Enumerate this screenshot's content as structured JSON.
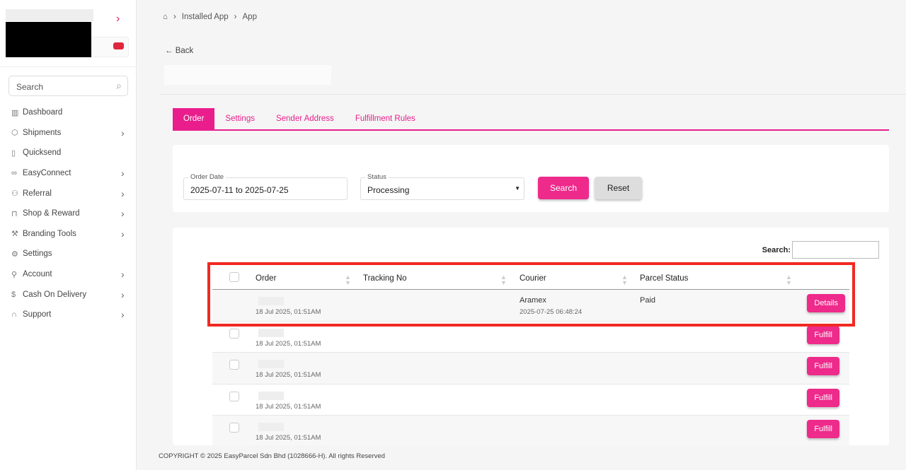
{
  "sidebar": {
    "search_placeholder": "Search",
    "items": [
      {
        "label": "Dashboard",
        "icon": "chart-icon",
        "ch": false
      },
      {
        "label": "Shipments",
        "icon": "box-icon",
        "ch": true
      },
      {
        "label": "Quicksend",
        "icon": "quicksend-icon",
        "ch": false
      },
      {
        "label": "EasyConnect",
        "icon": "link-icon",
        "ch": true
      },
      {
        "label": "Referral",
        "icon": "user-plus-icon",
        "ch": true
      },
      {
        "label": "Shop & Reward",
        "icon": "bag-icon",
        "ch": true
      },
      {
        "label": "Branding Tools",
        "icon": "wrench-icon",
        "ch": true
      },
      {
        "label": "Settings",
        "icon": "gear-icon",
        "ch": false
      },
      {
        "label": "Account",
        "icon": "user-icon",
        "ch": true
      },
      {
        "label": "Cash On Delivery",
        "icon": "dollar-icon",
        "ch": true
      },
      {
        "label": "Support",
        "icon": "headset-icon",
        "ch": true
      }
    ]
  },
  "breadcrumb": [
    "Installed App",
    "App"
  ],
  "back": "Back",
  "tabs": [
    "Order",
    "Settings",
    "Sender Address",
    "Fulfillment Rules"
  ],
  "filters": {
    "order_date_label": "Order Date",
    "order_date": "2025-07-11 to 2025-07-25",
    "status_label": "Status",
    "status": "Processing",
    "search": "Search",
    "reset": "Reset"
  },
  "table": {
    "search_label": "Search:",
    "headers": [
      "Order",
      "Tracking No",
      "Courier",
      "Parcel Status"
    ],
    "rows": [
      {
        "date": "18 Jul 2025, 01:51AM",
        "courier": "Aramex",
        "courier_time": "2025-07-25 06:48:24",
        "status": "Paid",
        "action": "Details"
      },
      {
        "date": "18 Jul 2025, 01:51AM",
        "action": "Fulfill"
      },
      {
        "date": "18 Jul 2025, 01:51AM",
        "action": "Fulfill"
      },
      {
        "date": "18 Jul 2025, 01:51AM",
        "action": "Fulfill"
      },
      {
        "date": "18 Jul 2025, 01:51AM",
        "action": "Fulfill"
      }
    ]
  },
  "footer": "COPYRIGHT © 2025 EasyParcel Sdn Bhd (1028666-H). All rights Reserved",
  "colors": {
    "accent": "#ee2a8b",
    "highlight": "#f02a22"
  }
}
